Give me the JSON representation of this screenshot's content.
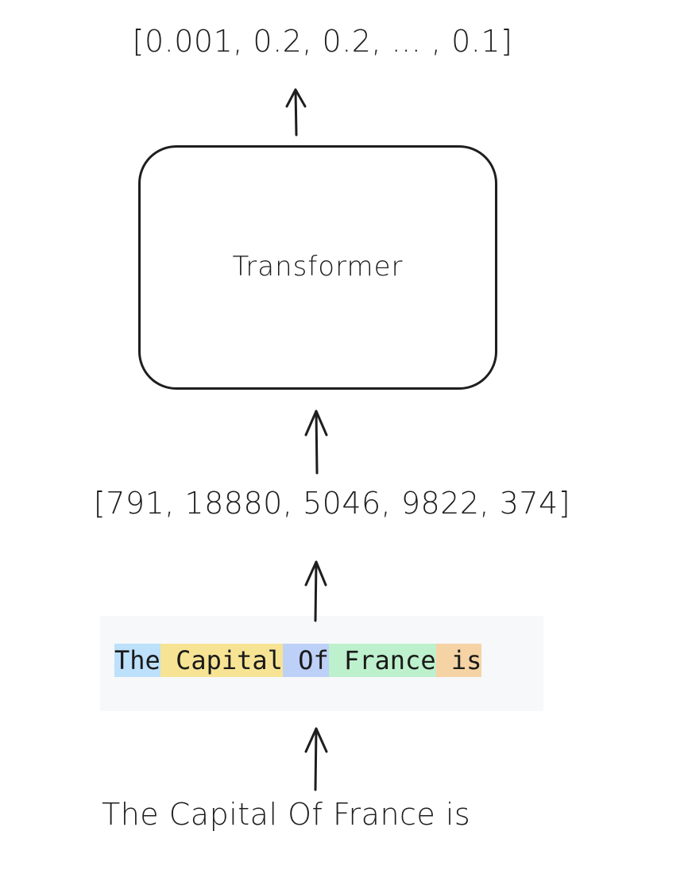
{
  "diagram": {
    "output_probabilities": "[0.001, 0.2, 0.2, ... , 0.1]",
    "model_label": "Transformer",
    "token_ids": "[791, 18880, 5046, 9822, 374]",
    "tokens": [
      {
        "text": "The",
        "color": "#bde0fb"
      },
      {
        "text": " Capital",
        "color": "#f6e494"
      },
      {
        "text": " Of",
        "color": "#bdd0f8"
      },
      {
        "text": " France",
        "color": "#bdf0cc"
      },
      {
        "text": " is",
        "color": "#f5d3a5"
      }
    ],
    "input_text": "The Capital Of France is"
  }
}
